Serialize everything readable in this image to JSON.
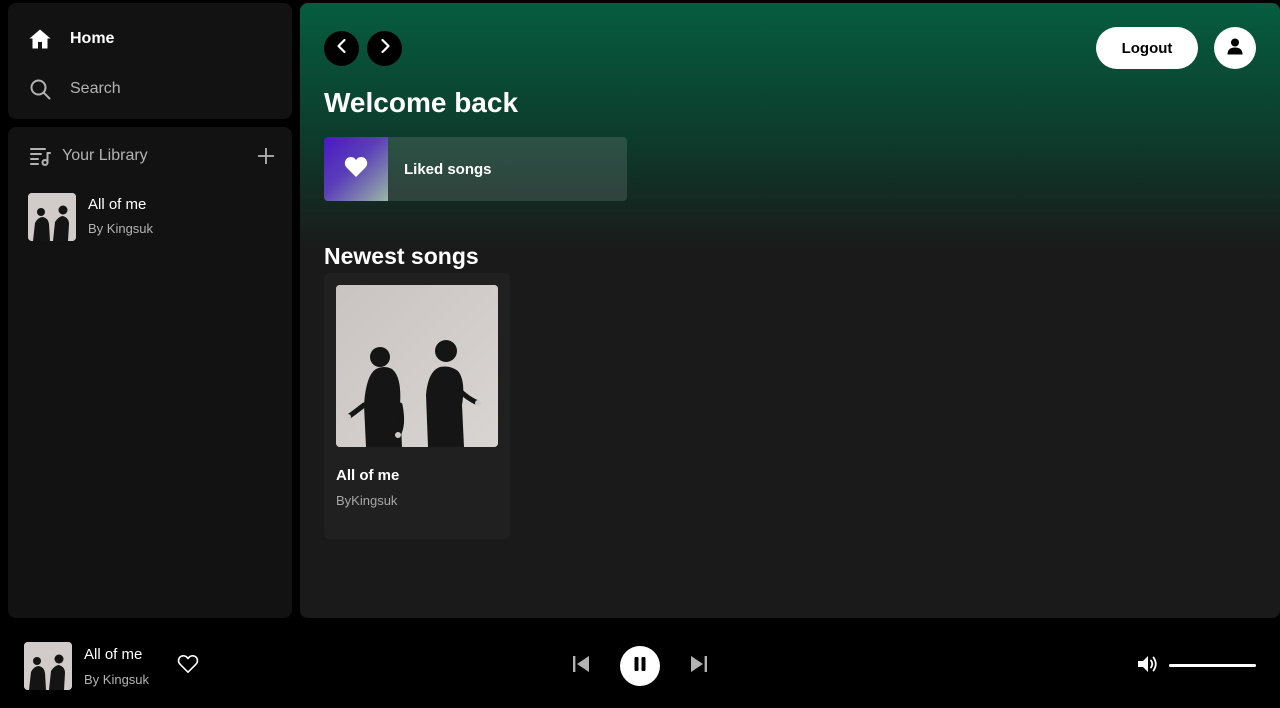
{
  "nav": {
    "home_label": "Home",
    "search_label": "Search"
  },
  "library": {
    "title": "Your Library",
    "items": [
      {
        "title": "All of me",
        "subtitle": "By Kingsuk"
      }
    ]
  },
  "header": {
    "logout_label": "Logout"
  },
  "main": {
    "welcome": "Welcome back",
    "liked_label": "Liked songs",
    "newest_title": "Newest songs",
    "songs": [
      {
        "title": "All of me",
        "subtitle": "ByKingsuk"
      }
    ]
  },
  "player": {
    "title": "All of me",
    "artist": "By Kingsuk",
    "volume": 1.0,
    "state": "playing"
  },
  "colors": {
    "accent_green": "#065d40",
    "panel_bg": "#121212",
    "liked_gradient_start": "#4c17c5"
  }
}
